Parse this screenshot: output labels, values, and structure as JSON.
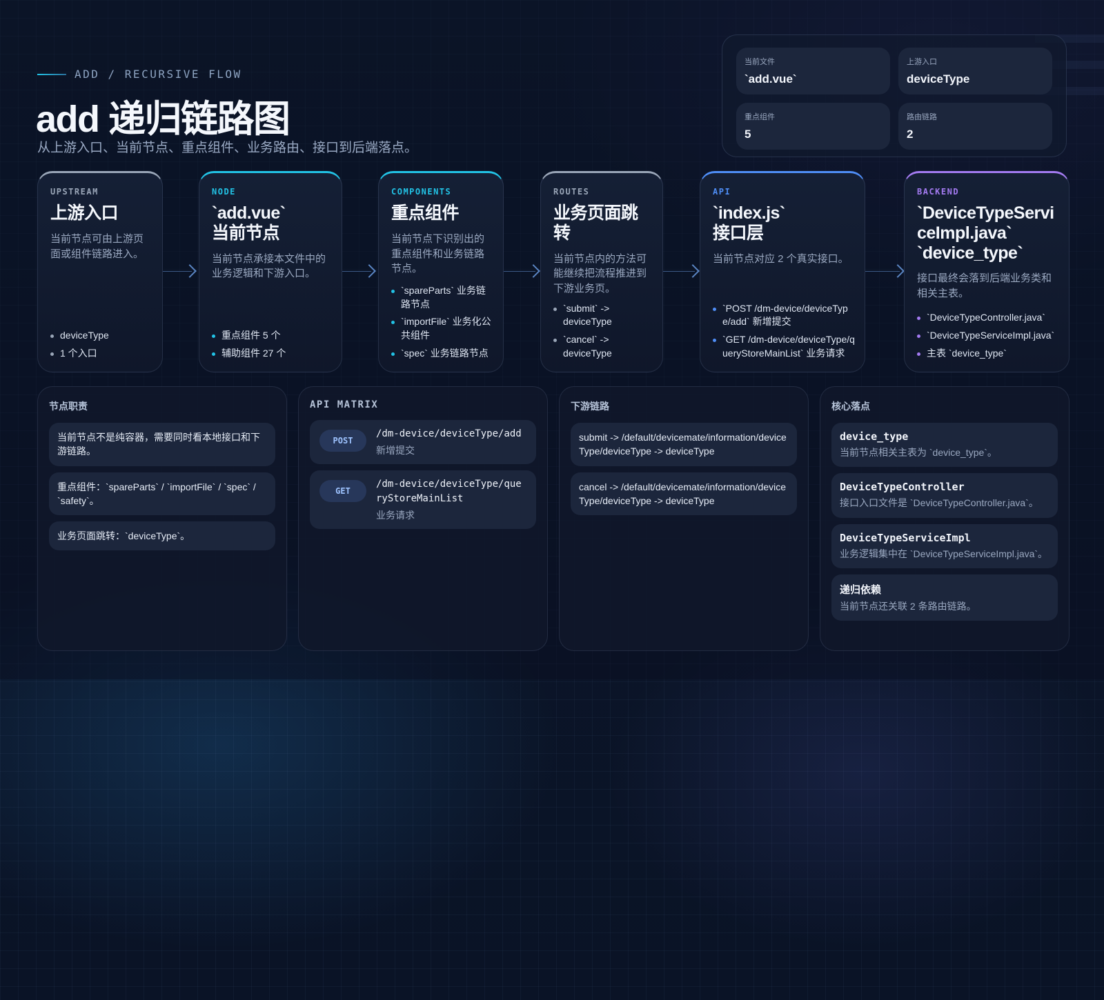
{
  "header": {
    "eyebrow": "ADD / RECURSIVE FLOW",
    "title": "add 递归链路图",
    "subtitle": "从上游入口、当前节点、重点组件、业务路由、接口到后端落点。"
  },
  "stats": [
    {
      "label": "当前文件",
      "value": "`add.vue`"
    },
    {
      "label": "上游入口",
      "value": "deviceType"
    },
    {
      "label": "重点组件",
      "value": "5"
    },
    {
      "label": "路由链路",
      "value": "2"
    }
  ],
  "flow": [
    {
      "tag": "UPSTREAM",
      "title": "上游入口",
      "desc": "当前节点可由上游页面或组件链路进入。",
      "items": [
        "deviceType",
        "1 个入口"
      ]
    },
    {
      "tag": "NODE",
      "title": "`add.vue`\n当前节点",
      "desc": "当前节点承接本文件中的业务逻辑和下游入口。",
      "items": [
        "重点组件 5 个",
        "辅助组件 27 个"
      ]
    },
    {
      "tag": "COMPONENTS",
      "title": "重点组件",
      "desc": "当前节点下识别出的重点组件和业务链路节点。",
      "items": [
        "`spareParts` 业务链路节点",
        "`importFile` 业务化公共组件",
        "`spec` 业务链路节点"
      ]
    },
    {
      "tag": "ROUTES",
      "title": "业务页面跳转",
      "desc": "当前节点内的方法可能继续把流程推进到下游业务页。",
      "items": [
        "`submit` -> deviceType",
        "`cancel` -> deviceType"
      ]
    },
    {
      "tag": "API",
      "title": "`index.js`\n接口层",
      "desc": "当前节点对应 2 个真实接口。",
      "items": [
        "`POST /dm-device/deviceType/add` 新增提交",
        "`GET /dm-device/deviceType/queryStoreMainList` 业务请求"
      ]
    },
    {
      "tag": "BACKEND",
      "title": "`DeviceTypeServiceImpl.java`\n`device_type`",
      "desc": "接口最终会落到后端业务类和相关主表。",
      "items": [
        "`DeviceTypeController.java`",
        "`DeviceTypeServiceImpl.java`",
        "主表 `device_type`"
      ]
    }
  ],
  "colors": {
    "upstream": "#9aa6b8",
    "node": "#22c3e6",
    "components": "#22c3e6",
    "routes": "#9aa6b8",
    "api": "#4f8ef7",
    "backend": "#a47bf2"
  },
  "responsibility": {
    "heading": "节点职责",
    "items": [
      "当前节点不是纯容器，需要同时看本地接口和下游链路。",
      "重点组件：`spareParts` / `importFile` / `spec` / `safety`。",
      "业务页面跳转：`deviceType`。"
    ]
  },
  "api_matrix": {
    "heading": "API MATRIX",
    "rows": [
      {
        "method": "POST",
        "path": "/dm-device/deviceType/add",
        "note": "新增提交"
      },
      {
        "method": "GET",
        "path": "/dm-device/deviceType/queryStoreMainList",
        "note": "业务请求"
      }
    ]
  },
  "downstream": {
    "heading": "下游链路",
    "items": [
      "submit -> /default/devicemate/information/deviceType/deviceType -> deviceType",
      "cancel -> /default/devicemate/information/deviceType/deviceType -> deviceType"
    ]
  },
  "core": {
    "heading": "核心落点",
    "items": [
      {
        "title": "device_type",
        "desc": "当前节点相关主表为 `device_type`。"
      },
      {
        "title": "DeviceTypeController",
        "desc": "接口入口文件是 `DeviceTypeController.java`。"
      },
      {
        "title": "DeviceTypeServiceImpl",
        "desc": "业务逻辑集中在 `DeviceTypeServiceImpl.java`。"
      },
      {
        "title": "递归依赖",
        "desc": "当前节点还关联 2 条路由链路。"
      }
    ]
  }
}
